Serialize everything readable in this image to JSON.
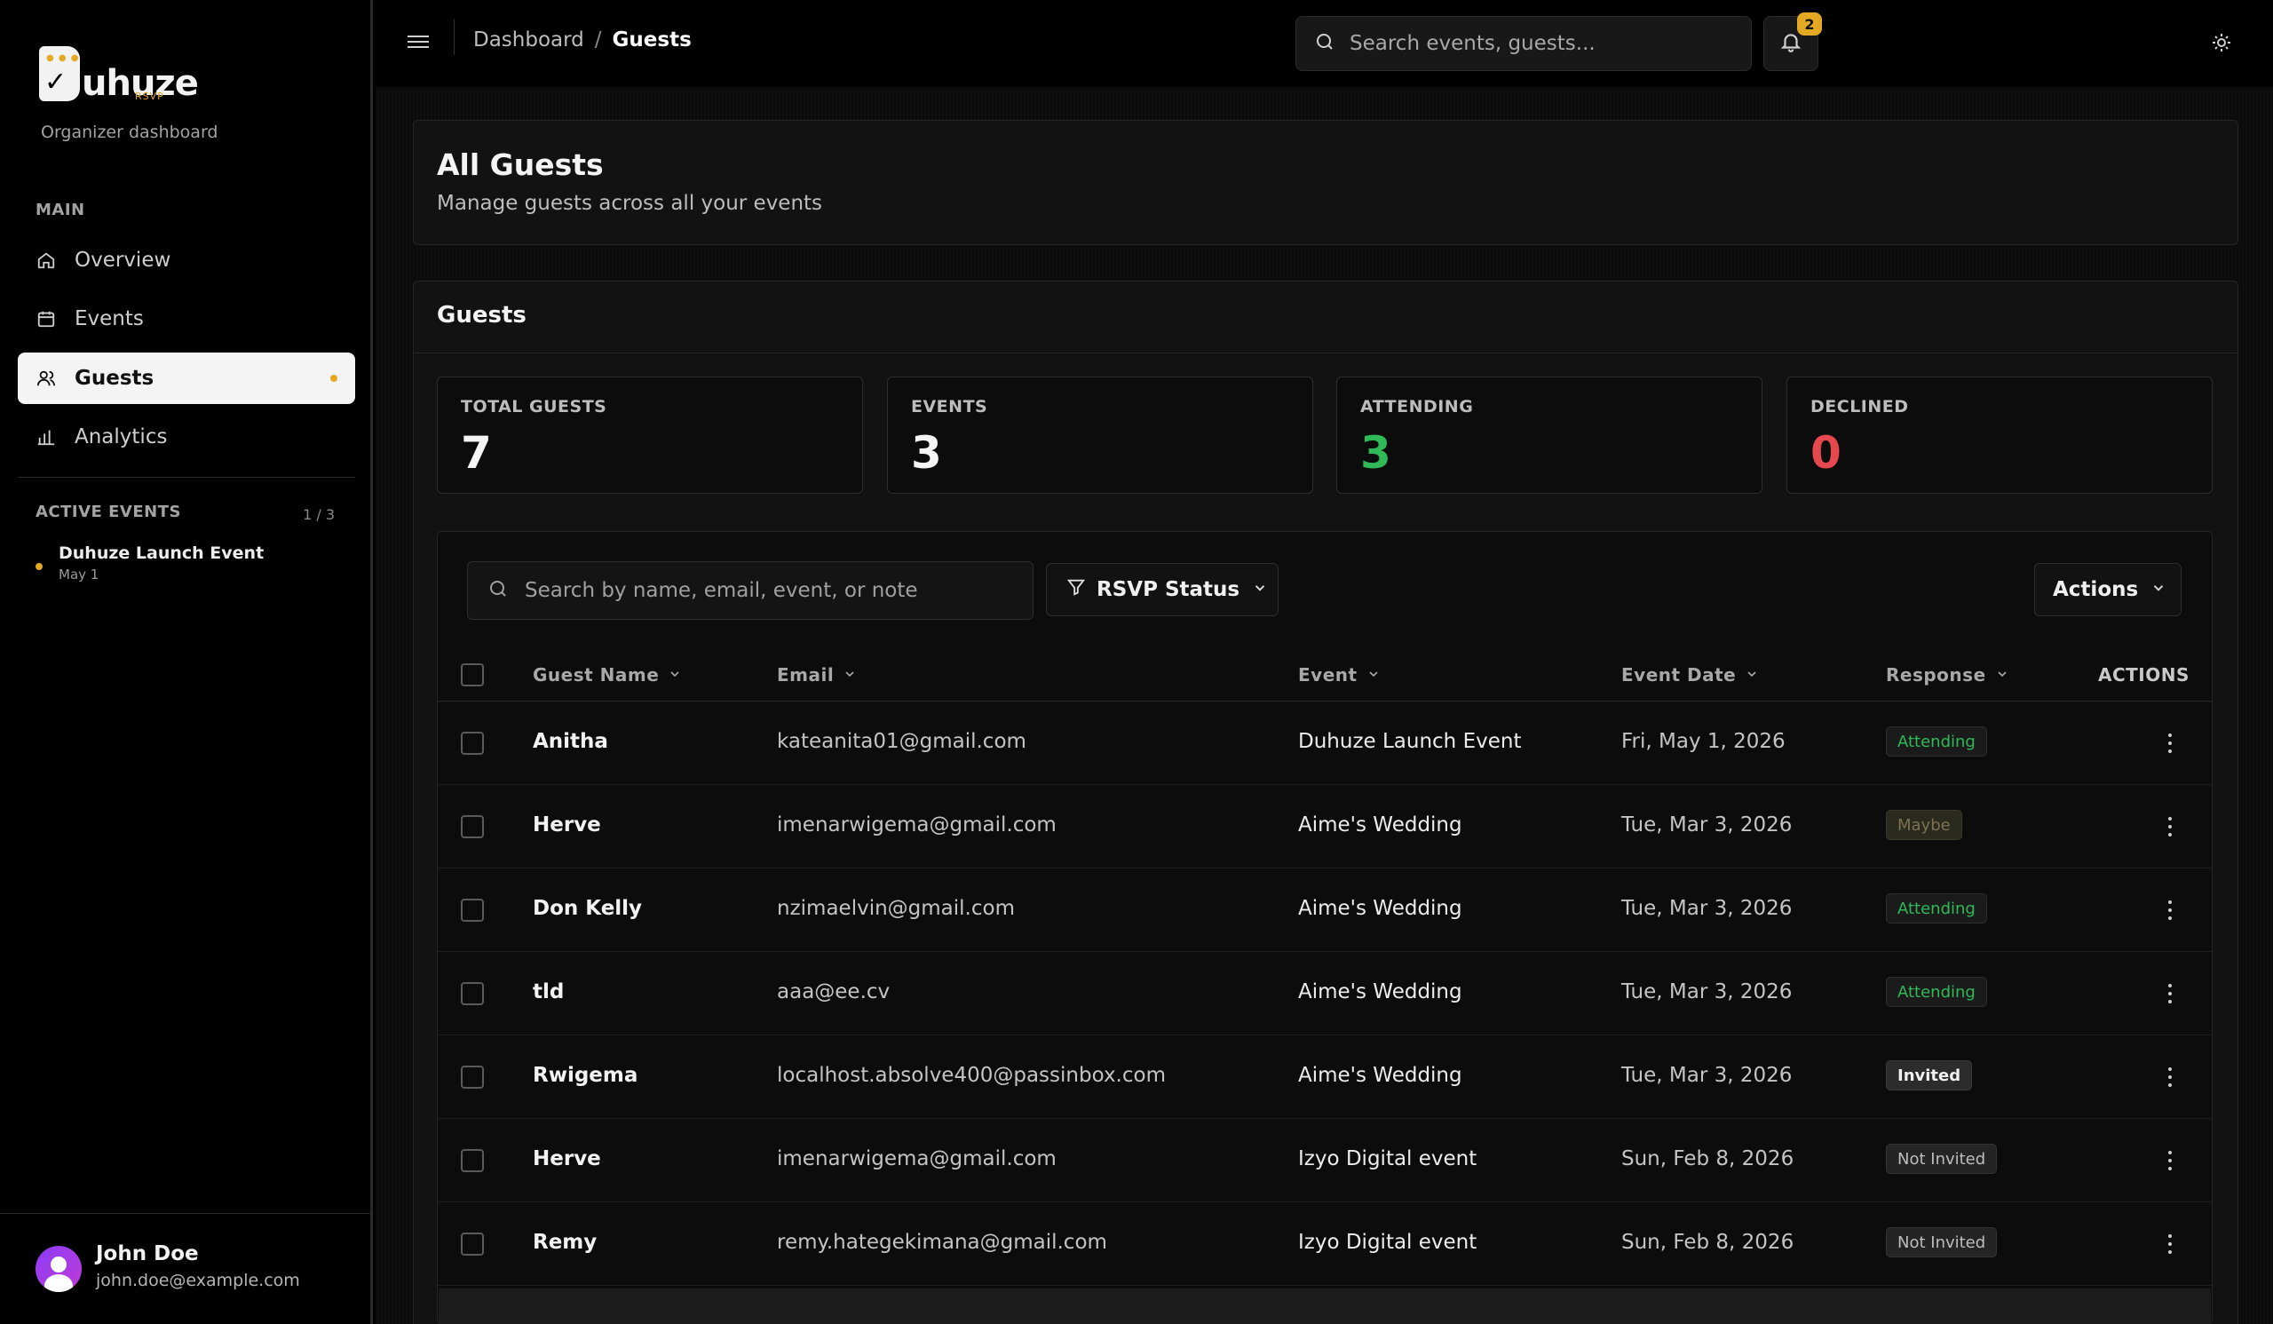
{
  "brand": {
    "name": "uhuze",
    "sub": "RSVP",
    "org_label": "Organizer dashboard"
  },
  "sidebar": {
    "main_label": "MAIN",
    "items": [
      {
        "label": "Overview",
        "icon": "home-icon"
      },
      {
        "label": "Events",
        "icon": "calendar-icon"
      },
      {
        "label": "Guests",
        "icon": "users-icon",
        "active": true
      },
      {
        "label": "Analytics",
        "icon": "bar-chart-icon"
      }
    ],
    "active_events_label": "ACTIVE EVENTS",
    "active_events_count": "1 / 3",
    "active_events": [
      {
        "title": "Duhuze Launch Event",
        "date": "May 1"
      }
    ]
  },
  "user": {
    "name": "John Doe",
    "email": "john.doe@example.com"
  },
  "topbar": {
    "breadcrumb": [
      "Dashboard",
      "Guests"
    ],
    "search_placeholder": "Search events, guests...",
    "notification_count": "2"
  },
  "page": {
    "title": "All Guests",
    "subtitle": "Manage guests across all your events"
  },
  "guests": {
    "title": "Guests",
    "stats": [
      {
        "label": "TOTAL GUESTS",
        "value": "7",
        "color": "#f4f4f4"
      },
      {
        "label": "EVENTS",
        "value": "3",
        "color": "#f4f4f4"
      },
      {
        "label": "ATTENDING",
        "value": "3",
        "color": "#2fb957"
      },
      {
        "label": "DECLINED",
        "value": "0",
        "color": "#e5484d"
      }
    ],
    "search_placeholder": "Search by name, email, event, or note",
    "rsvp_filter_label": "RSVP Status",
    "actions_label": "Actions",
    "columns": [
      "Guest Name",
      "Email",
      "Event",
      "Event Date",
      "Response",
      "ACTIONS"
    ],
    "rows": [
      {
        "name": "Anitha",
        "email": "kateanita01@gmail.com",
        "event": "Duhuze Launch Event",
        "date": "Fri, May 1, 2026",
        "response": "Attending",
        "status": "attending"
      },
      {
        "name": "Herve",
        "email": "imenarwigema@gmail.com",
        "event": "Aime's Wedding",
        "date": "Tue, Mar 3, 2026",
        "response": "Maybe",
        "status": "maybe"
      },
      {
        "name": "Don Kelly",
        "email": "nzimaelvin@gmail.com",
        "event": "Aime's Wedding",
        "date": "Tue, Mar 3, 2026",
        "response": "Attending",
        "status": "attending"
      },
      {
        "name": "tld",
        "email": "aaa@ee.cv",
        "event": "Aime's Wedding",
        "date": "Tue, Mar 3, 2026",
        "response": "Attending",
        "status": "attending"
      },
      {
        "name": "Rwigema",
        "email": "localhost.absolve400@passinbox.com",
        "event": "Aime's Wedding",
        "date": "Tue, Mar 3, 2026",
        "response": "Invited",
        "status": "invited"
      },
      {
        "name": "Herve",
        "email": "imenarwigema@gmail.com",
        "event": "Izyo Digital event",
        "date": "Sun, Feb 8, 2026",
        "response": "Not Invited",
        "status": "notinvited"
      },
      {
        "name": "Remy",
        "email": "remy.hategekimana@gmail.com",
        "event": "Izyo Digital event",
        "date": "Sun, Feb 8, 2026",
        "response": "Not Invited",
        "status": "notinvited"
      }
    ]
  },
  "colors": {
    "accent": "#e3a922",
    "attending": "#2fb957",
    "declined": "#e5484d",
    "background": "#000000"
  }
}
